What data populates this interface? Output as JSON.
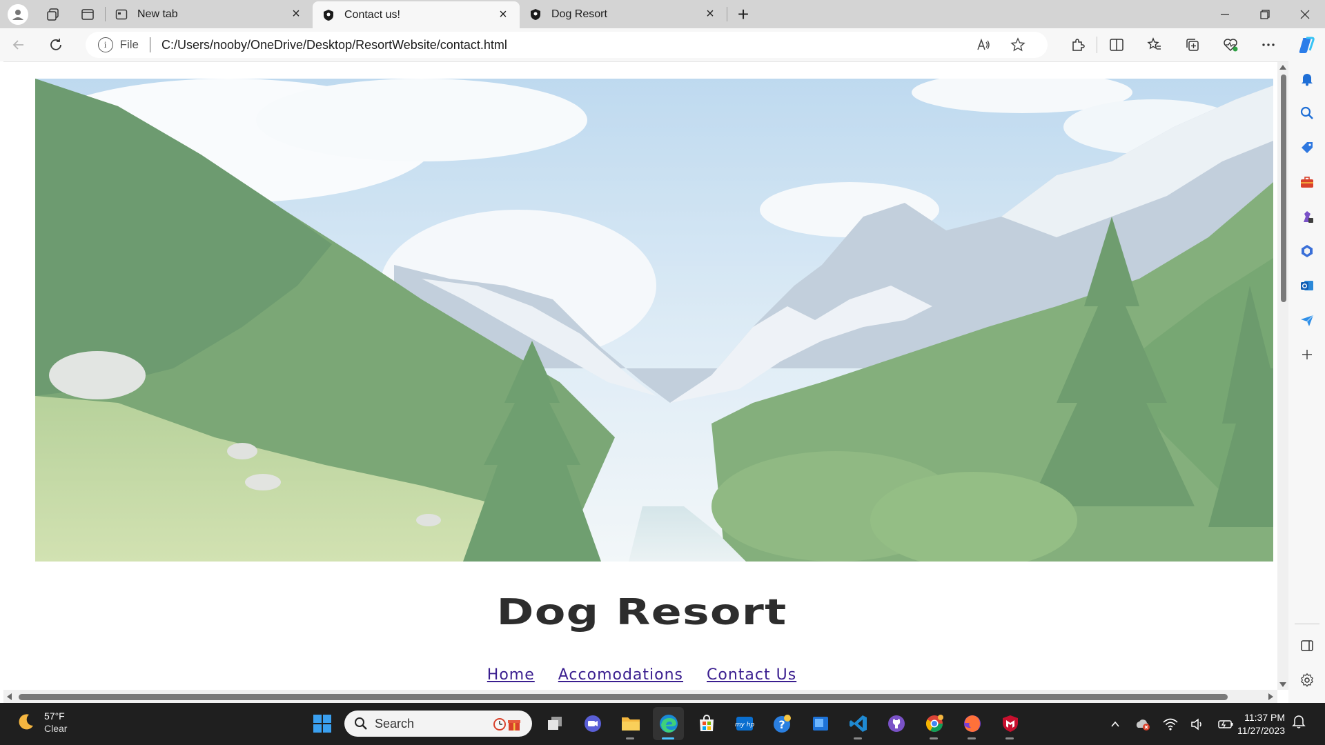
{
  "browser": {
    "tabs": [
      {
        "title": "New tab",
        "active": false
      },
      {
        "title": "Contact us!",
        "active": true
      },
      {
        "title": "Dog Resort",
        "active": false
      }
    ],
    "address": {
      "scheme": "File",
      "url": "C:/Users/nooby/OneDrive/Desktop/ResortWebsite/contact.html"
    }
  },
  "page": {
    "title": "Dog Resort",
    "nav": [
      "Home",
      "Accomodations",
      "Contact Us"
    ],
    "hero_description": "mountain valley landscape with pine forest and river"
  },
  "taskbar": {
    "weather": {
      "temp": "57°F",
      "condition": "Clear"
    },
    "search_label": "Search",
    "clock": {
      "time": "11:37 PM",
      "date": "11/27/2023"
    }
  },
  "colors": {
    "accent": "#4cc2ff",
    "link": "#3a1e8f",
    "title": "#2d2d2d",
    "taskbar": "#1f1f1f"
  }
}
